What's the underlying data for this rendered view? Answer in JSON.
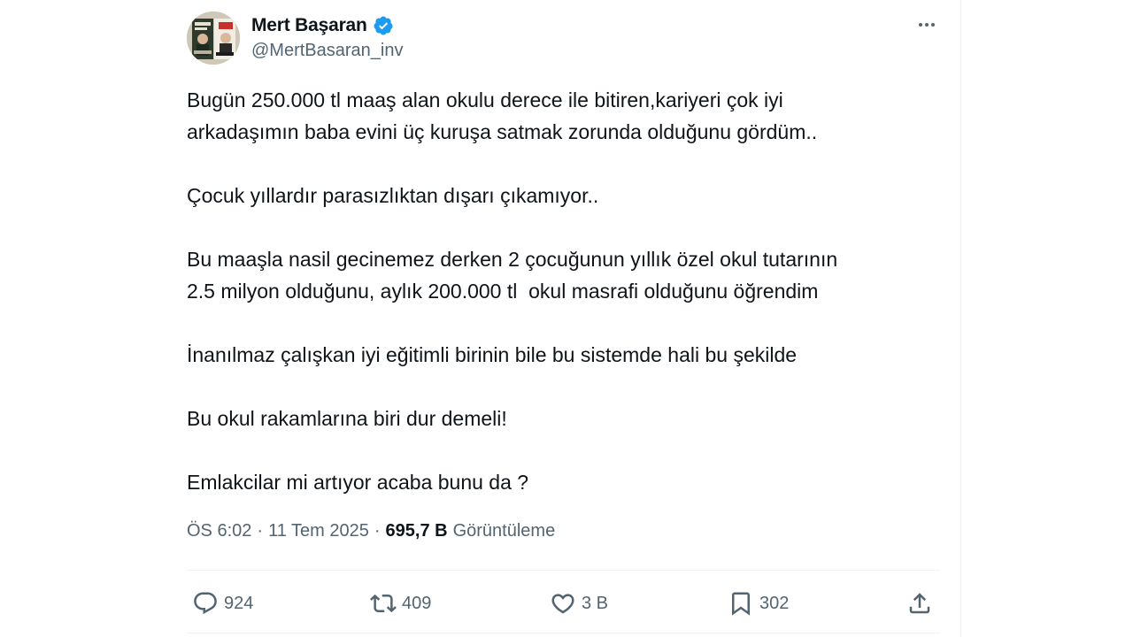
{
  "author": {
    "display_name": "Mert Başaran",
    "handle": "@MertBasaran_inv",
    "verified": true,
    "avatar_icon": "book-covers-avatar"
  },
  "tweet": {
    "paragraphs": [
      [
        "Bugün 250.000 tl maaş alan okulu derece ile bitiren,kariyeri çok iyi",
        "arkadaşımın baba evini üç kuruşa satmak zorunda olduğunu gördüm.."
      ],
      [
        "Çocuk yıllardır parasızlıktan dışarı çıkamıyor.."
      ],
      [
        "Bu maaşla nasil gecinemez derken 2 çocuğunun yıllık özel okul tutarının",
        "2.5 milyon olduğunu, aylık 200.000 tl  okul masrafi olduğunu öğrendim"
      ],
      [
        "İnanılmaz çalışkan iyi eğitimli birinin bile bu sistemde hali bu şekilde"
      ],
      [
        "Bu okul rakamlarına biri dur demeli!"
      ],
      [
        "Emlakcilar mi artıyor acaba bunu da ?"
      ]
    ]
  },
  "meta": {
    "time": "ÖS 6:02",
    "date": "11 Tem 2025",
    "separator": "·",
    "views_count": "695,7 B",
    "views_label": "Görüntüleme"
  },
  "actions": {
    "replies": "924",
    "retweets": "409",
    "likes": "3 B",
    "bookmarks": "302"
  },
  "colors": {
    "text": "#0f1419",
    "secondary": "#536471",
    "verified": "#1d9bf0",
    "divider": "#eff3f4"
  }
}
